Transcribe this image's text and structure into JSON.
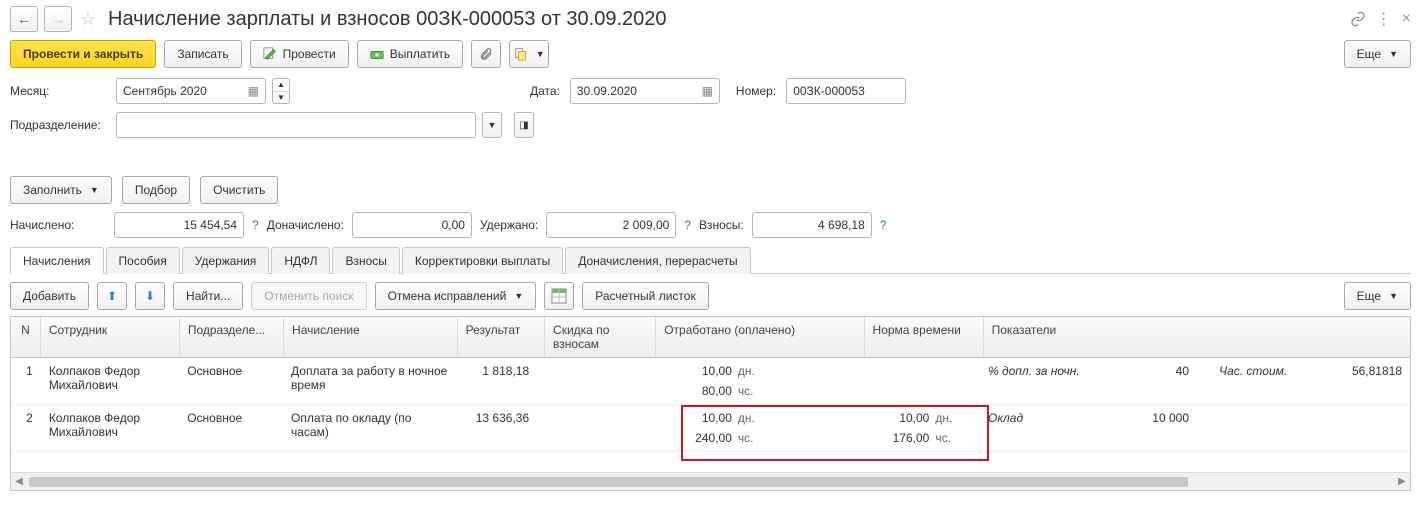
{
  "header": {
    "title": "Начисление зарплаты и взносов 00ЗК-000053 от 30.09.2020"
  },
  "toolbar": {
    "post_close": "Провести и закрыть",
    "record": "Записать",
    "post": "Провести",
    "pay": "Выплатить",
    "more": "Еще"
  },
  "form": {
    "month_label": "Месяц:",
    "month_value": "Сентябрь 2020",
    "date_label": "Дата:",
    "date_value": "30.09.2020",
    "number_label": "Номер:",
    "number_value": "00ЗК-000053",
    "division_label": "Подразделение:",
    "division_value": ""
  },
  "actions": {
    "fill": "Заполнить",
    "pick": "Подбор",
    "clear": "Очистить"
  },
  "totals": {
    "accrued_label": "Начислено:",
    "accrued": "15 454,54",
    "extra_label": "Доначислено:",
    "extra": "0,00",
    "withheld_label": "Удержано:",
    "withheld": "2 009,00",
    "contrib_label": "Взносы:",
    "contrib": "4 698,18",
    "help": "?"
  },
  "tabs": {
    "t1": "Начисления",
    "t2": "Пособия",
    "t3": "Удержания",
    "t4": "НДФЛ",
    "t5": "Взносы",
    "t6": "Корректировки выплаты",
    "t7": "Доначисления, перерасчеты"
  },
  "subbar": {
    "add": "Добавить",
    "find": "Найти...",
    "cancel_search": "Отменить поиск",
    "cancel_fix": "Отмена исправлений",
    "payslip": "Расчетный листок",
    "more": "Еще"
  },
  "table": {
    "hdr": {
      "n": "N",
      "emp": "Сотрудник",
      "div": "Подразделе...",
      "accr": "Начисление",
      "res": "Результат",
      "disc": "Скидка по взносам",
      "worked": "Отработано (оплачено)",
      "norm": "Норма времени",
      "ind": "Показатели"
    },
    "rows": [
      {
        "n": "1",
        "emp": "Колпаков Федор Михайлович",
        "div": "Основное",
        "accr": "Доплата за работу в ночное время",
        "res": "1 818,18",
        "worked_dn": "10,00",
        "worked_dn_u": "дн.",
        "worked_ch": "80,00",
        "worked_ch_u": "чс.",
        "norm_dn": "",
        "norm_dn_u": "",
        "norm_ch": "",
        "norm_ch_u": "",
        "ind1_label": "% допл. за ночн.",
        "ind1_val": "40",
        "ind2_label": "Час. стоим.",
        "ind2_val": "56,81818"
      },
      {
        "n": "2",
        "emp": "Колпаков Федор Михайлович",
        "div": "Основное",
        "accr": "Оплата по окладу (по часам)",
        "res": "13 636,36",
        "worked_dn": "10,00",
        "worked_dn_u": "дн.",
        "worked_ch": "240,00",
        "worked_ch_u": "чс.",
        "norm_dn": "10,00",
        "norm_dn_u": "дн.",
        "norm_ch": "176,00",
        "norm_ch_u": "чс.",
        "ind1_label": "Оклад",
        "ind1_val": "10 000",
        "ind2_label": "",
        "ind2_val": ""
      }
    ]
  }
}
